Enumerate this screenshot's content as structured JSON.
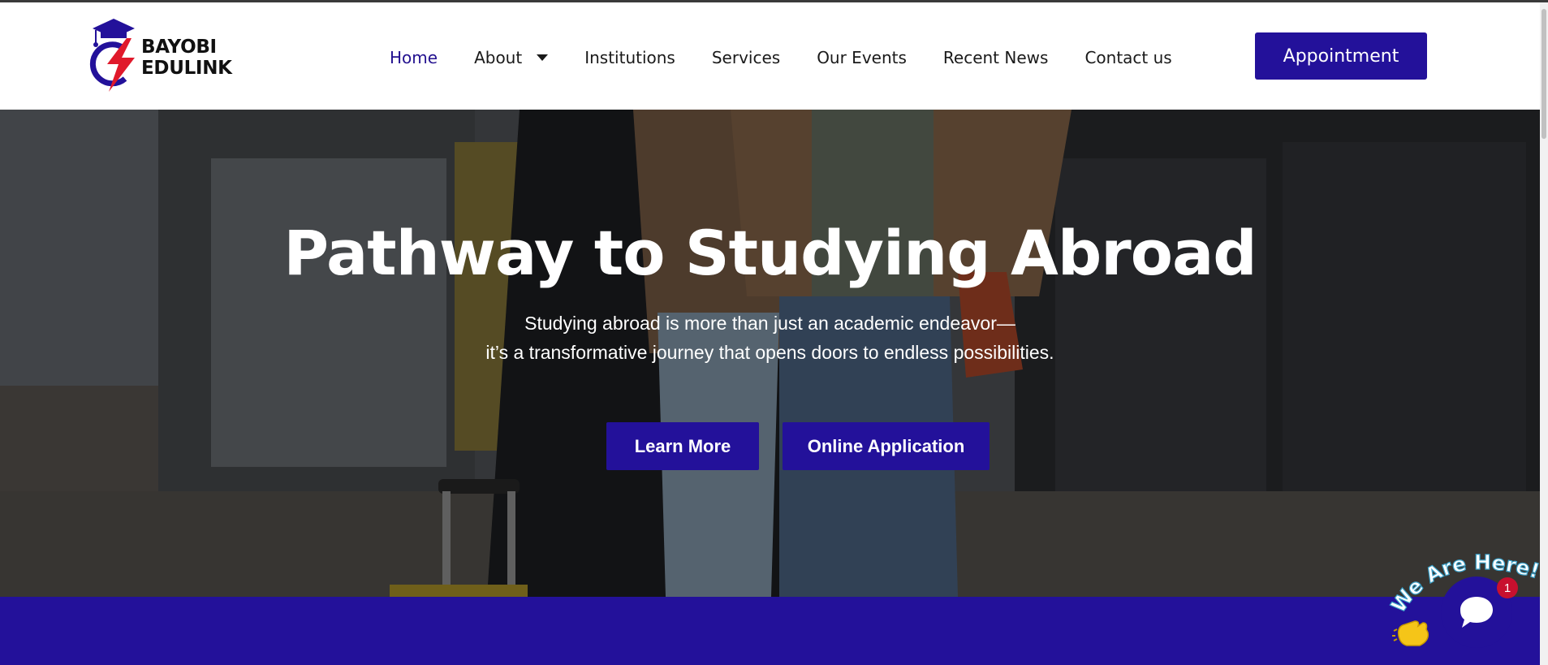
{
  "brand": {
    "name": "BAYOBI EDULINK",
    "accent": "#23119a",
    "bolt_color": "#e0192b"
  },
  "nav": {
    "items": [
      {
        "label": "Home",
        "active": true
      },
      {
        "label": "About",
        "dropdown": true
      },
      {
        "label": "Institutions"
      },
      {
        "label": "Services"
      },
      {
        "label": "Our Events"
      },
      {
        "label": "Recent News"
      },
      {
        "label": "Contact us"
      }
    ],
    "cta": "Appointment"
  },
  "hero": {
    "title": "Pathway to Studying Abroad",
    "subtitle_line1": "Studying abroad is more than just an academic endeavor—",
    "subtitle_line2": "it’s a transformative journey that opens doors to endless possibilities.",
    "buttons": {
      "learn_more": "Learn More",
      "online_application": "Online Application"
    }
  },
  "chat": {
    "banner": "We Are Here!",
    "badge_count": "1",
    "icon": "chat-bubble-icon",
    "wave_icon": "waving-hand-icon"
  }
}
